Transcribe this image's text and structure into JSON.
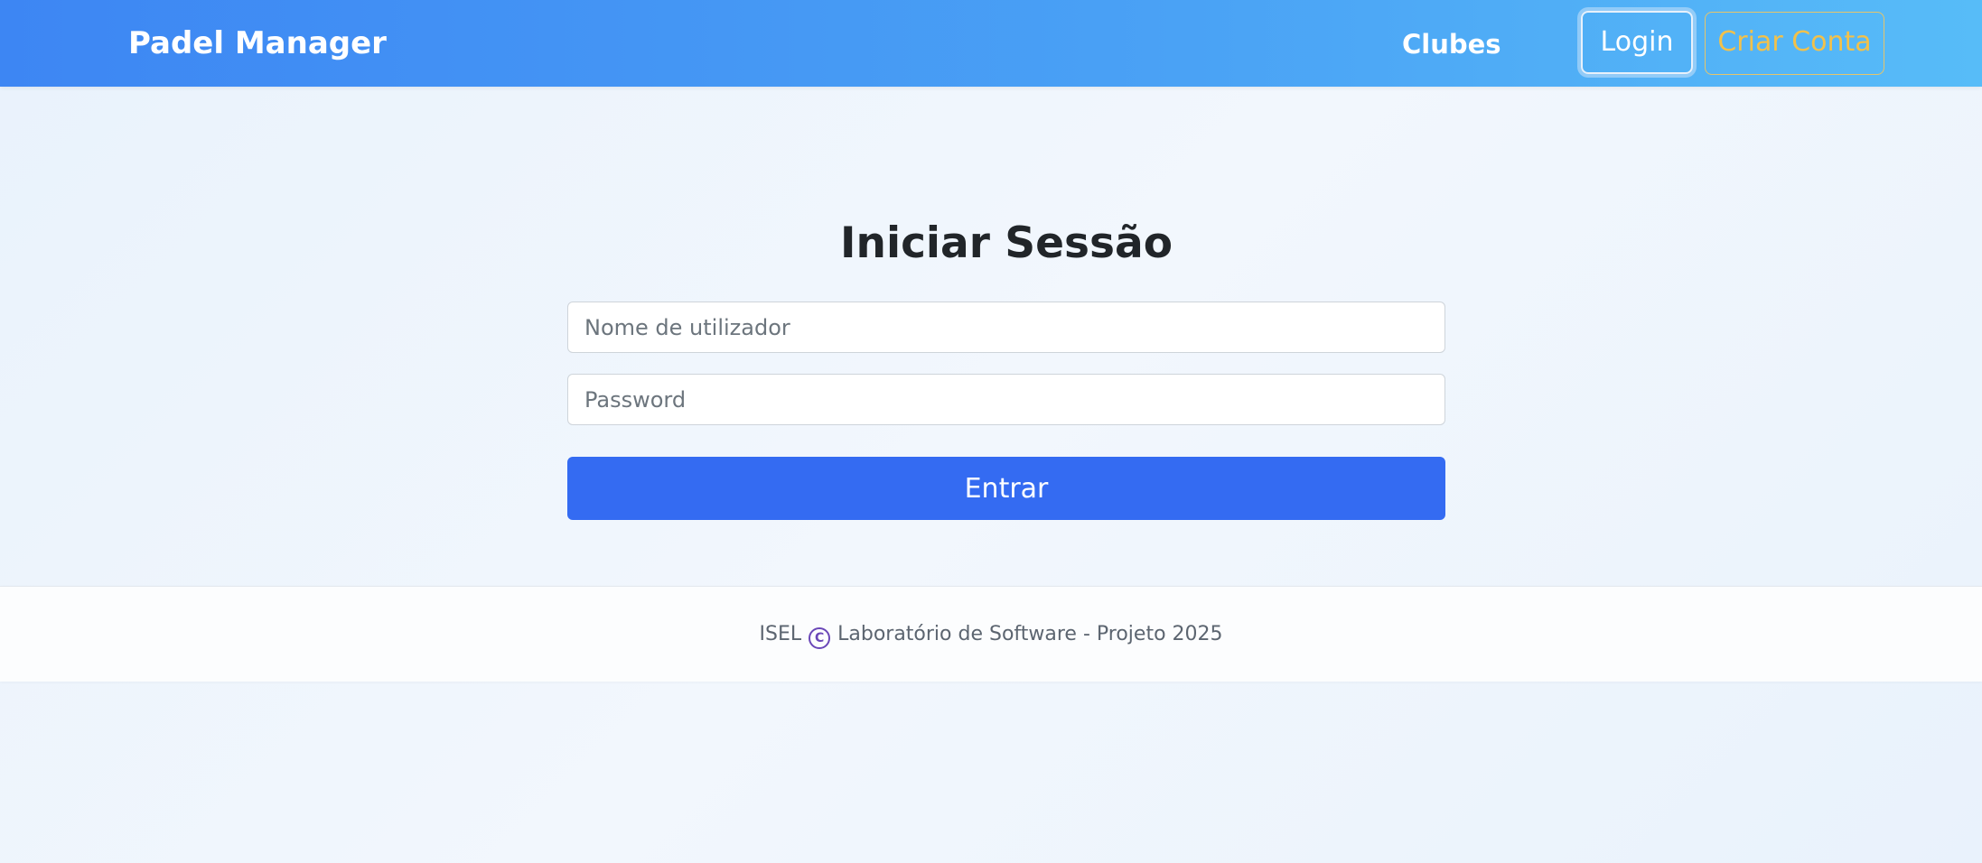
{
  "navbar": {
    "brand": "Padel Manager",
    "clubs_link": "Clubes",
    "login_button": "Login",
    "signup_button": "Criar Conta"
  },
  "login_form": {
    "title": "Iniciar Sessão",
    "username": {
      "value": "",
      "placeholder": "Nome de utilizador"
    },
    "password": {
      "value": "",
      "placeholder": "Password"
    },
    "submit_label": "Entrar"
  },
  "footer": {
    "left_text": "ISEL",
    "icon": "copyright-icon",
    "icon_glyph": "C",
    "right_text": "Laboratório de Software - Projeto 2025"
  },
  "colors": {
    "navbar_gradient_start": "#3d86f3",
    "navbar_gradient_end": "#57bcf8",
    "primary_button": "#346bf2",
    "signup_accent": "#f2c14a",
    "copyright_icon": "#6a47b8"
  }
}
